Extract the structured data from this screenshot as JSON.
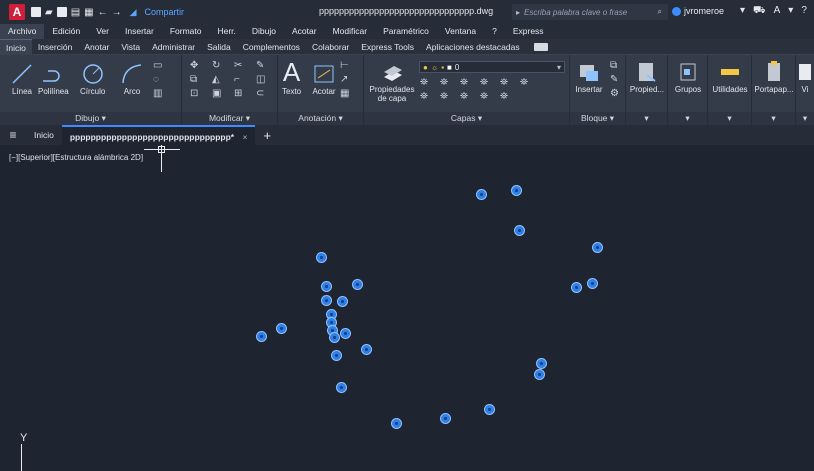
{
  "titlebar": {
    "logo": "A",
    "share": "Compartir",
    "document": "ppppppppppppppppppppppppppppppp.dwg",
    "search_placeholder": "Escriba palabra clave o frase",
    "user": "jvromeroe"
  },
  "menubar": [
    "Archivo",
    "Edición",
    "Ver",
    "Insertar",
    "Formato",
    "Herr.",
    "Dibujo",
    "Acotar",
    "Modificar",
    "Paramétrico",
    "Ventana",
    "?",
    "Express"
  ],
  "ribbon_tabs": [
    "Inicio",
    "Inserción",
    "Anotar",
    "Vista",
    "Administrar",
    "Salida",
    "Complementos",
    "Colaborar",
    "Express Tools",
    "Aplicaciones destacadas"
  ],
  "ribbon": {
    "draw_tools": [
      "Línea",
      "Polilínea",
      "Círculo",
      "Arco"
    ],
    "draw_panel": "Dibujo ▾",
    "modify_panel": "Modificar ▾",
    "text": "Texto",
    "dimension": "Acotar",
    "annotation_panel": "Anotación ▾",
    "layer_props": "Propiedades de capa",
    "layer_current": "0",
    "layers_panel": "Capas ▾",
    "insert": "Insertar",
    "block_panel": "Bloque ▾",
    "properties": "Propied...",
    "groups": "Grupos",
    "utilities": "Utilidades",
    "clipboard": "Portapap...",
    "view_partial": "Vi"
  },
  "filetabs": {
    "home": "Inicio",
    "active": "ppppppppppppppppppppppppppppppp*"
  },
  "viewport": {
    "label": "[−][Superior][Estructura alámbrica 2D]",
    "ucs_y": "Y"
  },
  "colors": {
    "point_fill": "#2f7fe4",
    "canvas_bg": "#1e2430",
    "accent": "#3d8cff"
  }
}
